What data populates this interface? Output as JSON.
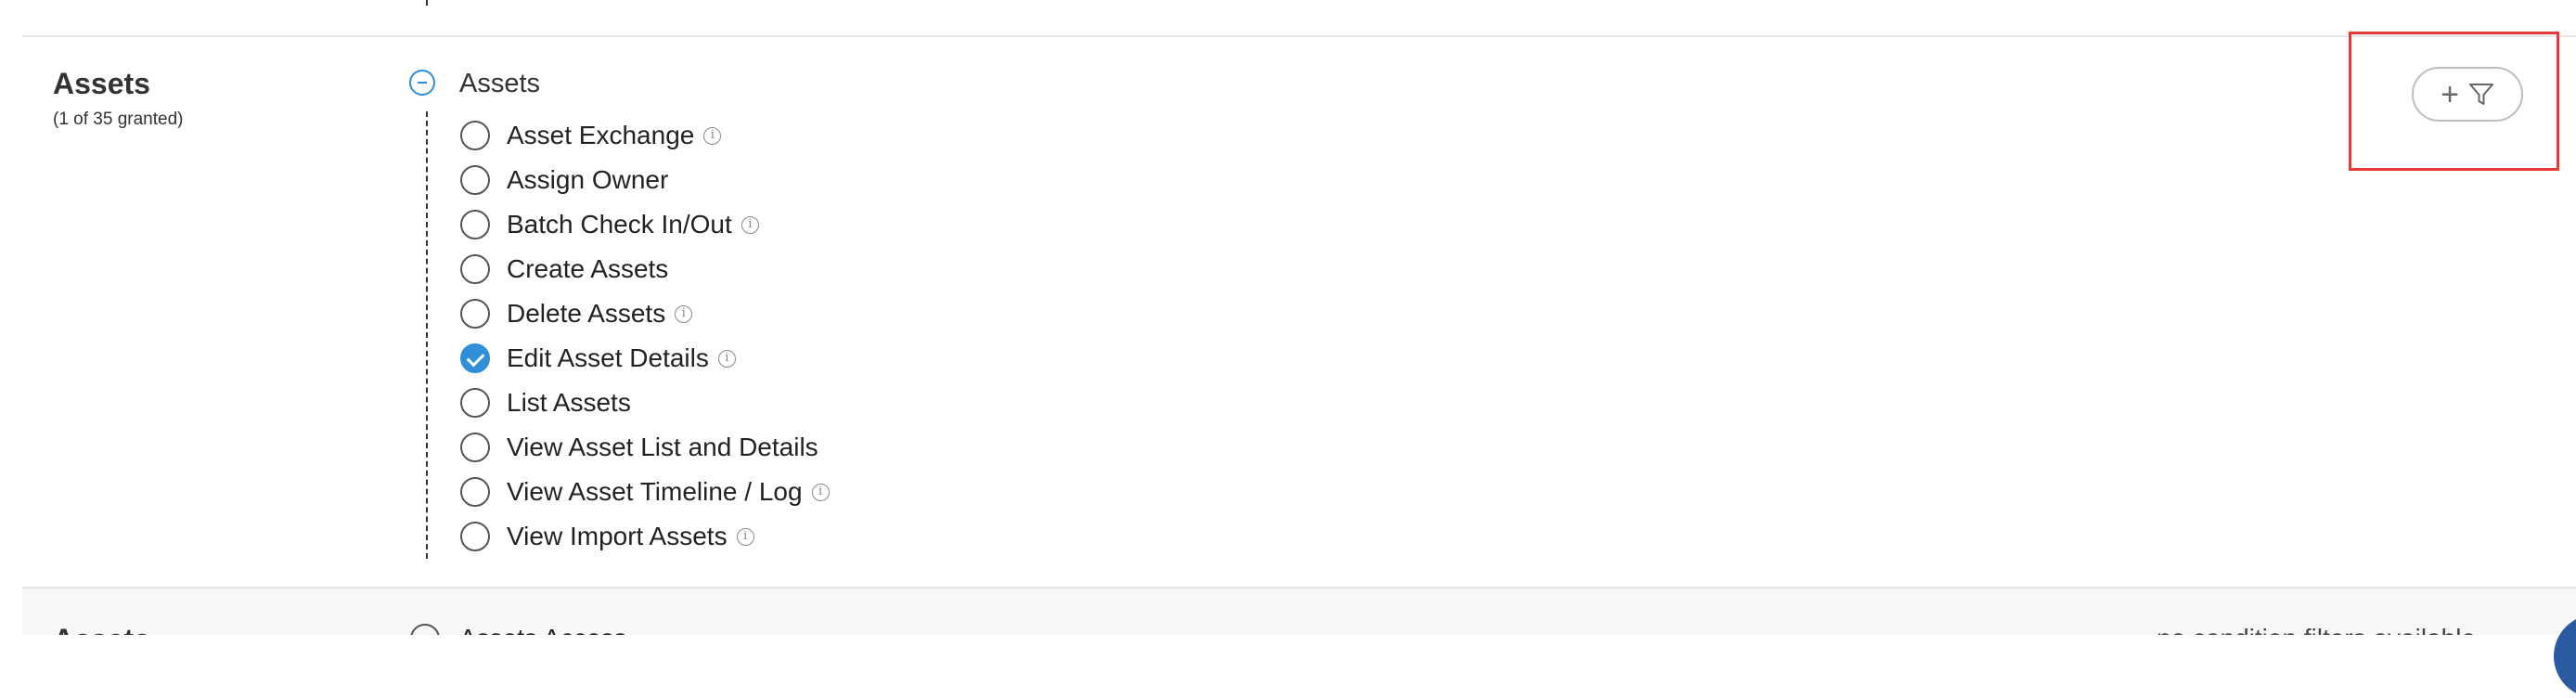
{
  "section": {
    "title": "Assets",
    "subtitle": "(1 of 35 granted)",
    "group_label": "Assets",
    "permissions": [
      {
        "label": "Asset Exchange",
        "checked": false,
        "info": true
      },
      {
        "label": "Assign Owner",
        "checked": false,
        "info": false
      },
      {
        "label": "Batch Check In/Out",
        "checked": false,
        "info": true
      },
      {
        "label": "Create Assets",
        "checked": false,
        "info": false
      },
      {
        "label": "Delete Assets",
        "checked": false,
        "info": true
      },
      {
        "label": "Edit Asset Details",
        "checked": true,
        "info": true
      },
      {
        "label": "List Assets",
        "checked": false,
        "info": false
      },
      {
        "label": "View Asset List and Details",
        "checked": false,
        "info": false
      },
      {
        "label": "View Asset Timeline / Log",
        "checked": false,
        "info": true
      },
      {
        "label": "View Import Assets",
        "checked": false,
        "info": true
      }
    ],
    "info_glyph": "i"
  },
  "filter_button": {
    "icon_plus": "+",
    "icon_name": "add-filter-icon"
  },
  "next_section": {
    "title": "Assets",
    "first_item": "Assets Access",
    "note": "no condition filters available"
  },
  "colors": {
    "accent": "#2f8fd8",
    "highlight": "#e53935",
    "fab": "#2c5aa0"
  }
}
